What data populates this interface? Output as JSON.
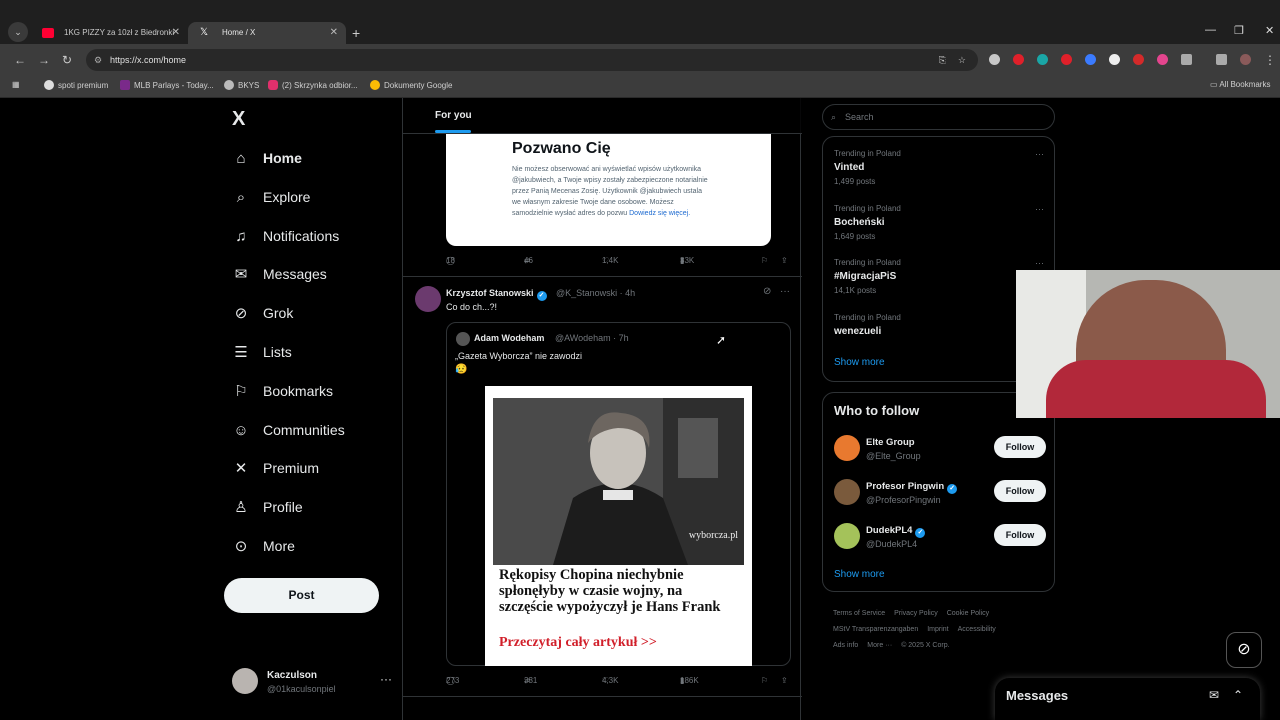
{
  "browser": {
    "tabs": [
      {
        "title": "1KG PIZZY za 10zł z Biedronki",
        "active": false
      },
      {
        "title": "Home / X",
        "active": true
      }
    ],
    "url": "https://x.com/home",
    "bookmarks": [
      "spoti premium",
      "MLB Parlays - Today...",
      "BKYS",
      "(2) Skrzynka odbior...",
      "Dokumenty Google"
    ],
    "all_bookmarks": "All Bookmarks"
  },
  "nav": {
    "logo": "X",
    "items": [
      {
        "label": "Home",
        "icon": "home-icon"
      },
      {
        "label": "Explore",
        "icon": "search-icon"
      },
      {
        "label": "Notifications",
        "icon": "bell-icon"
      },
      {
        "label": "Messages",
        "icon": "envelope-icon"
      },
      {
        "label": "Grok",
        "icon": "grok-icon"
      },
      {
        "label": "Lists",
        "icon": "lists-icon"
      },
      {
        "label": "Bookmarks",
        "icon": "bookmark-icon"
      },
      {
        "label": "Communities",
        "icon": "communities-icon"
      },
      {
        "label": "Premium",
        "icon": "x-premium-icon"
      },
      {
        "label": "Profile",
        "icon": "profile-icon"
      },
      {
        "label": "More",
        "icon": "more-circle-icon"
      }
    ],
    "post": "Post",
    "account": {
      "name": "Kaczulson",
      "handle": "@01kaculsonpiel"
    }
  },
  "feed": {
    "tab": "For you",
    "card1": {
      "title": "Pozwano Cię",
      "body": "Nie możesz obserwować ani wyświetlać wpisów użytkownika @jakubwiech, a Twoje wpisy zostały zabezpieczone notarialnie przez Panią Mecenas Zosię. Użytkownik @jakubwiech ustala we własnym zakresie Twoje dane osobowe. Możesz samodzielnie wysłać adres do pozwu",
      "link": "Dowiedz się więcej."
    },
    "post1_stats": {
      "replies": "18",
      "reposts": "46",
      "likes": "1,4K",
      "views": "33K"
    },
    "post2": {
      "name": "Krzysztof Stanowski",
      "handle": "@K_Stanowski · 4h",
      "text": "Co do ch...?!",
      "quote": {
        "name": "Adam Wodeham",
        "handle": "@AWodeham · 7h",
        "text": "„Gazeta Wyborcza” nie zawodzi",
        "emoji": "😥",
        "watermark": "wyborcza.pl",
        "headline": "Rękopisy Chopina niechybnie spłonęłyby w czasie wojny, na szczęście wypożyczył je Hans Frank",
        "link": "Przeczytaj cały artykuł >>"
      },
      "stats": {
        "replies": "273",
        "reposts": "331",
        "likes": "4,3K",
        "views": "186K"
      }
    }
  },
  "sidebar": {
    "search_placeholder": "Search",
    "trends": [
      {
        "context": "Trending in Poland",
        "name": "Vinted",
        "count": "1,499 posts"
      },
      {
        "context": "Trending in Poland",
        "name": "Bocheński",
        "count": "1,649 posts"
      },
      {
        "context": "Trending in Poland",
        "name": "#MigracjaPiS",
        "count": "14,1K posts"
      },
      {
        "context": "Trending in Poland",
        "name": "wenezueli",
        "count": ""
      }
    ],
    "show_more": "Show more",
    "who_to_follow": {
      "title": "Who to follow",
      "accounts": [
        {
          "name": "Elte Group",
          "handle": "@Elte_Group",
          "button": "Follow",
          "color": "#e8792f"
        },
        {
          "name": "Profesor Pingwin",
          "handle": "@ProfesorPingwin",
          "button": "Follow",
          "color": "#7a5a3c"
        },
        {
          "name": "DudekPL4",
          "handle": "@DudekPL4",
          "button": "Follow",
          "color": "#a4c25a"
        }
      ],
      "show_more": "Show more"
    },
    "footer": [
      "Terms of Service",
      "Privacy Policy",
      "Cookie Policy",
      "MStV Transparenzangaben",
      "Imprint",
      "Accessibility",
      "Ads info",
      "More ···",
      "© 2025 X Corp."
    ]
  },
  "messages_drawer": {
    "title": "Messages"
  }
}
